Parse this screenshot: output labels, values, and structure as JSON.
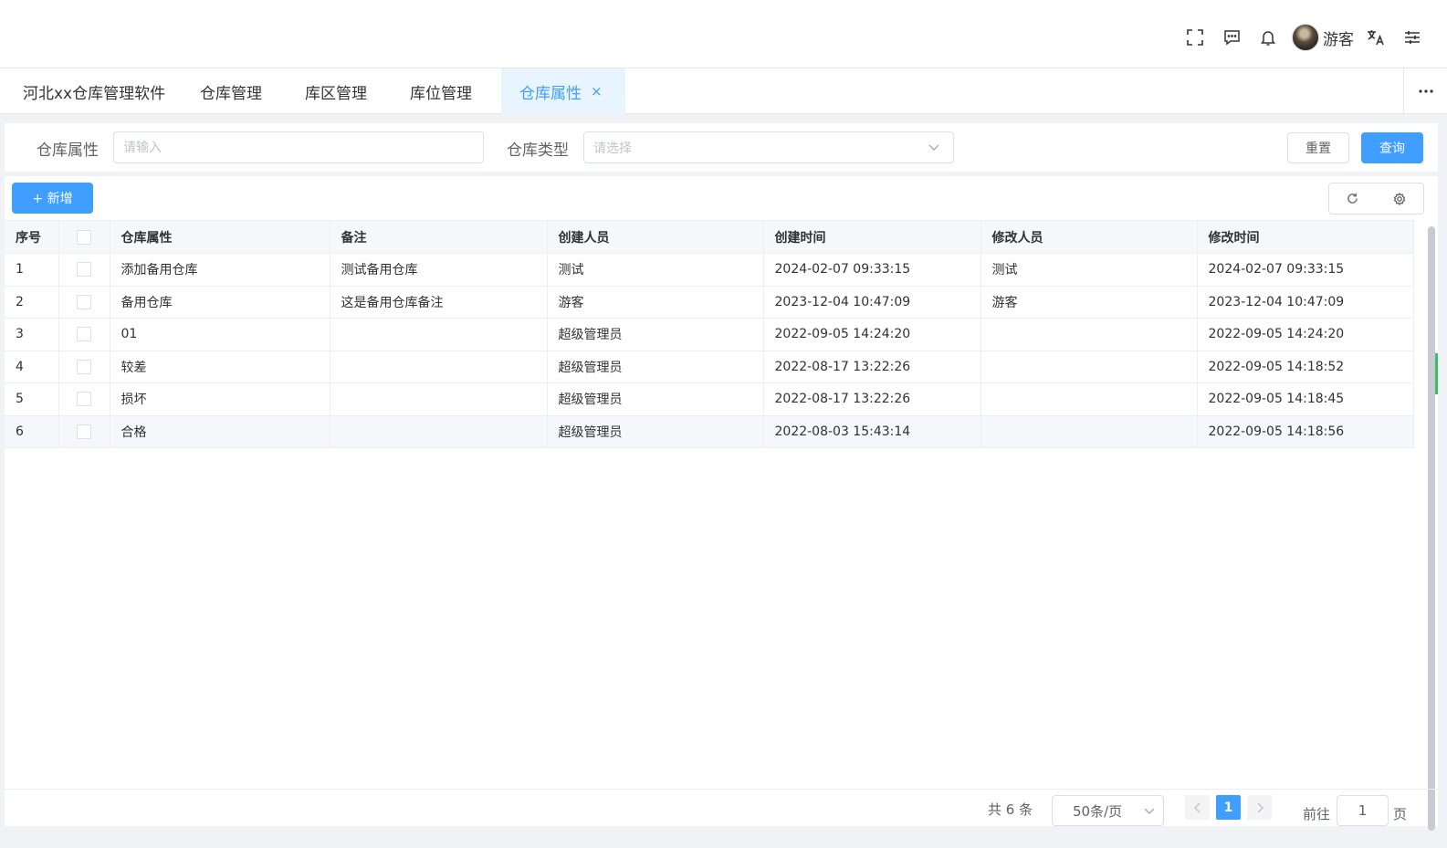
{
  "header": {
    "username": "游客",
    "icons": [
      "fullscreen-icon",
      "message-icon",
      "bell-icon",
      "translate-icon",
      "settings-sliders-icon"
    ]
  },
  "tabs": [
    {
      "label": "河北xx仓库管理软件",
      "active": false
    },
    {
      "label": "仓库管理",
      "active": false
    },
    {
      "label": "库区管理",
      "active": false
    },
    {
      "label": "库位管理",
      "active": false
    },
    {
      "label": "仓库属性",
      "active": true,
      "close": "×"
    }
  ],
  "search": {
    "property_label": "仓库属性",
    "property_placeholder": "请输入",
    "type_label": "仓库类型",
    "type_placeholder": "请选择",
    "reset_label": "重置",
    "query_label": "查询"
  },
  "toolbar": {
    "add_label": "+ 新增"
  },
  "table": {
    "columns": [
      "序号",
      "",
      "仓库属性",
      "备注",
      "创建人员",
      "创建时间",
      "修改人员",
      "修改时间"
    ],
    "rows": [
      [
        "1",
        "添加备用仓库",
        "测试备用仓库",
        "测试",
        "2024-02-07 09:33:15",
        "测试",
        "2024-02-07 09:33:15"
      ],
      [
        "2",
        "备用仓库",
        "这是备用仓库备注",
        "游客",
        "2023-12-04 10:47:09",
        "游客",
        "2023-12-04 10:47:09"
      ],
      [
        "3",
        "01",
        "",
        "超级管理员",
        "2022-09-05 14:24:20",
        "",
        "2022-09-05 14:24:20"
      ],
      [
        "4",
        "较差",
        "",
        "超级管理员",
        "2022-08-17 13:22:26",
        "",
        "2022-09-05 14:18:52"
      ],
      [
        "5",
        "损坏",
        "",
        "超级管理员",
        "2022-08-17 13:22:26",
        "",
        "2022-09-05 14:18:45"
      ],
      [
        "6",
        "合格",
        "",
        "超级管理员",
        "2022-08-03 15:43:14",
        "",
        "2022-09-05 14:18:56"
      ]
    ]
  },
  "pagination": {
    "total": "共 6 条",
    "page_size": "50条/页",
    "current_page": "1",
    "goto_prefix": "前往",
    "goto_value": "1",
    "goto_suffix": "页"
  }
}
